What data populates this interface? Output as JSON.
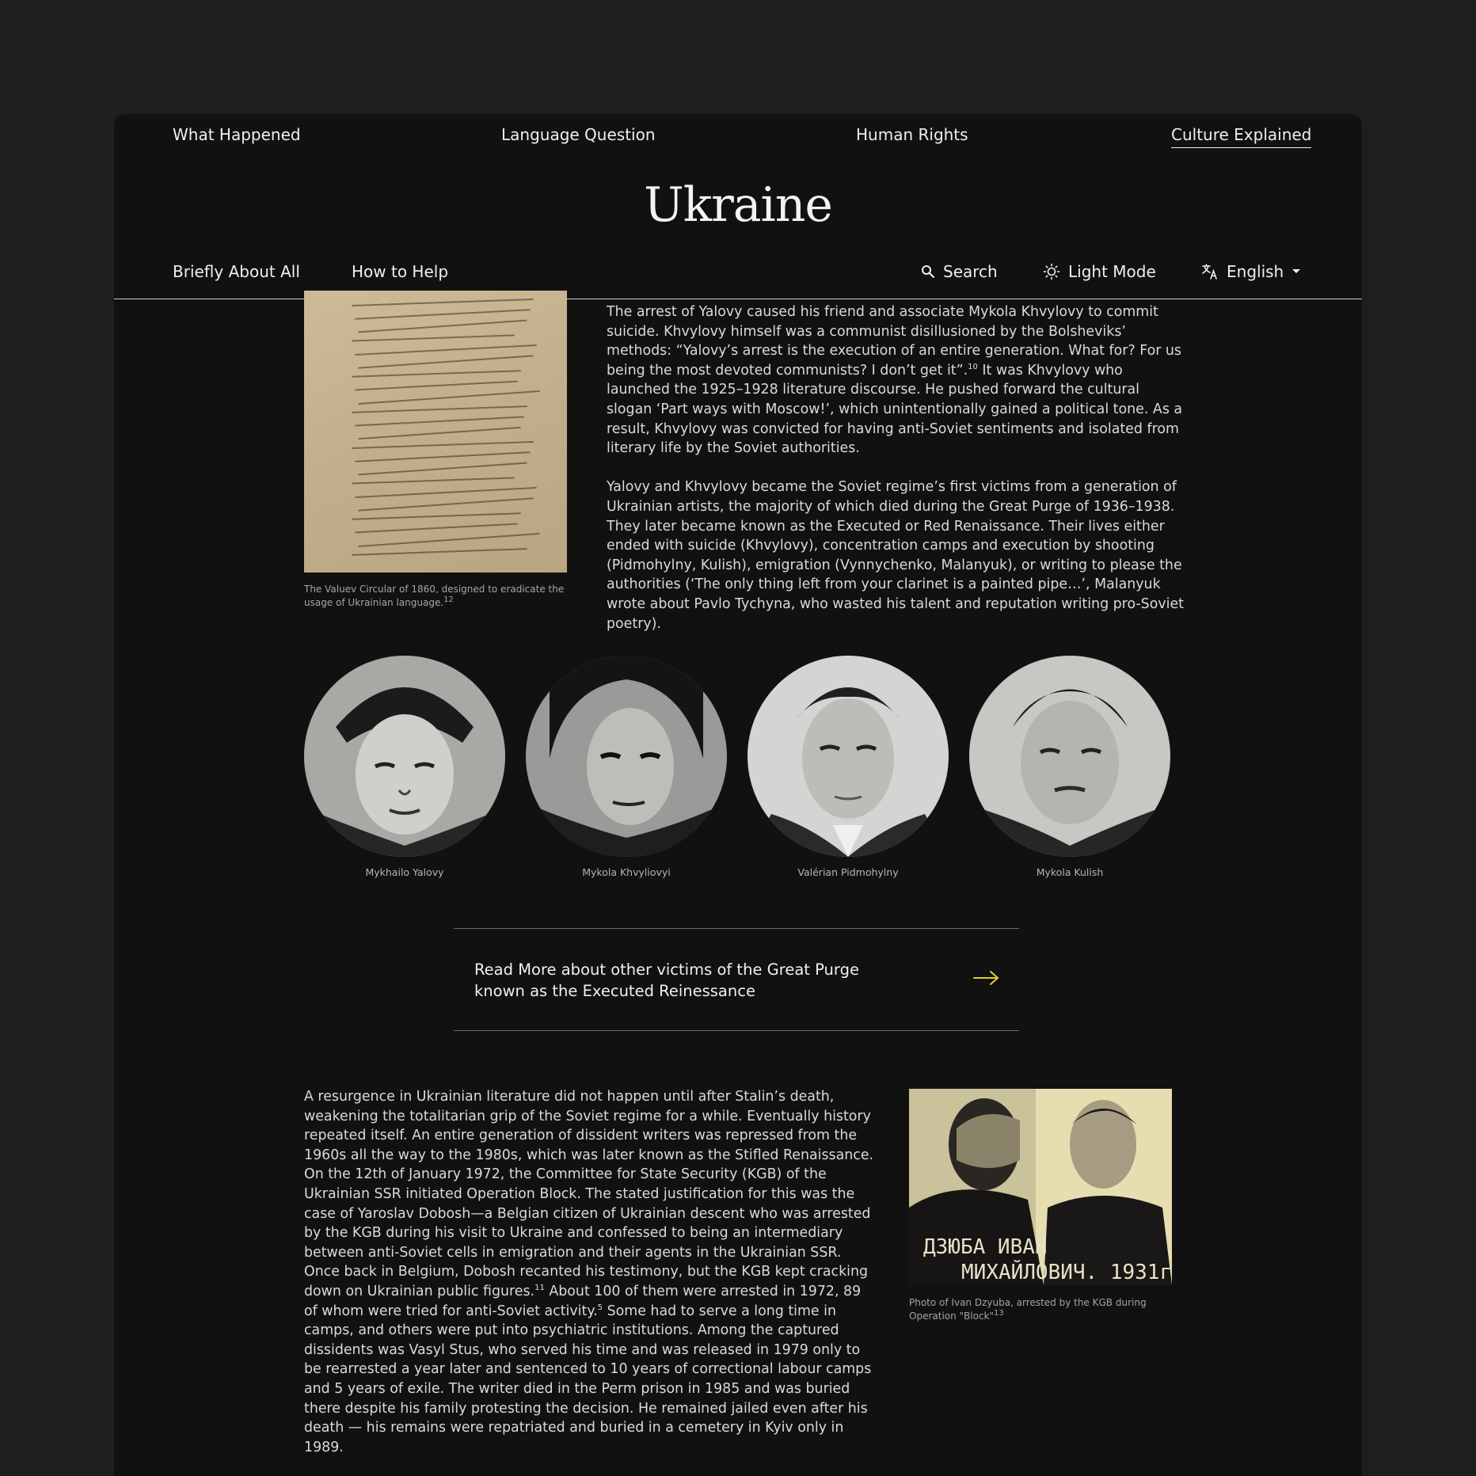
{
  "top_nav": [
    {
      "label": "What Happened",
      "active": false
    },
    {
      "label": "Language Question",
      "active": false
    },
    {
      "label": "Human Rights",
      "active": false
    },
    {
      "label": "Culture Explained",
      "active": true
    }
  ],
  "logo": "Ukraine",
  "sub_nav": {
    "briefly": "Briefly About All",
    "help": "How to Help",
    "search": "Search",
    "theme": "Light Mode",
    "language": "English"
  },
  "article": {
    "doc_caption": "The Valuev Circular of 1860, designed to eradicate the usage of Ukrainian language.",
    "doc_caption_note": "12",
    "para1_a": "The arrest of Yalovy caused his friend and associate Mykola Khvylovy to commit suicide. Khvylovy himself was a communist disillusioned by the Bolsheviks’ methods: “Yalovy’s arrest is the execution of an entire generation. What for? For us being the most devoted communists? I don’t get it”.",
    "para1_note": "10",
    "para1_b": " It was Khvylovy who launched the 1925–1928 literature discourse. He pushed forward the cultural slogan ‘Part ways with Moscow!’, which unintentionally gained a political tone. As a result, Khvylovy was convicted for having anti-Soviet sentiments and isolated from literary life by the Soviet authorities.",
    "para2": "Yalovy and Khvylovy became the Soviet regime’s first victims from a generation of Ukrainian artists, the majority of which died during the Great Purge of 1936–1938. They later became known as the Executed or Red Renaissance. Their lives either ended with suicide (Khvylovy), concentration camps and execution by shooting (Pidmohylny, Kulish), emigration (Vynnychenko, Malanyuk), or writing to please the authorities (‘The only thing left from your clarinet is a painted pipe…’, Malanyuk wrote about Pavlo Tychyna, who wasted his talent and reputation writing pro-Soviet poetry).",
    "portraits": [
      {
        "name": "Mykhailo Yalovy"
      },
      {
        "name": "Mykola Khvyliovyi"
      },
      {
        "name": "Valérian Pidmohylny"
      },
      {
        "name": "Mykola Kulish"
      }
    ],
    "read_more": "Read More about other victims of the Great Purge known as the Executed Reinessance",
    "para3_a": "A resurgence in Ukrainian literature did not happen until after Stalin’s death, weakening the totalitarian grip of the Soviet regime for a while. Eventually history repeated itself. An entire generation of dissident writers was repressed from the 1960s all the way to the 1980s, which was later known as the Stifled Renaissance. On the 12th of January 1972, the Committee for State Security (KGB) of the Ukrainian SSR initiated Operation Block. The stated justification for this was the case of Yaroslav Dobosh—a Belgian citizen of Ukrainian descent who was arrested by the KGB during his visit to Ukraine and confessed to being an intermediary between anti-Soviet cells in emigration and their agents in the Ukrainian SSR. Once back in Belgium, Dobosh recanted his testimony, but the KGB kept cracking down on Ukrainian public figures.",
    "para3_note1": "11",
    "para3_b": " About 100 of them were arrested in 1972, 89 of whom were tried for anti-Soviet activity.",
    "para3_note2": "5",
    "para3_c": " Some had to serve a long time in camps, and others were put into psychiatric institutions. Among the captured dissidents was Vasyl Stus, who served his time and was released in 1979 only to be rearrested a year later and sentenced to 10 years of correctional labour camps and 5 years of exile. The writer died in the Perm prison in 1985 and was buried there despite his family protesting the decision. He remained jailed even after his death — his remains were repatriated and buried in a cemetery in Kyiv only in 1989.",
    "photo_text_1": "ДЗЮБА   ИВАН",
    "photo_text_2": "МИХАЙЛОВИЧ. 1931г.",
    "photo_caption": "Photo of Ivan Dzyuba, arrested by the KGB during Operation \"Block\"",
    "photo_caption_note": "13"
  },
  "colors": {
    "page_bg": "#1f1e1e",
    "panel_bg": "#111111",
    "accent_arrow": "#d8d13a"
  }
}
